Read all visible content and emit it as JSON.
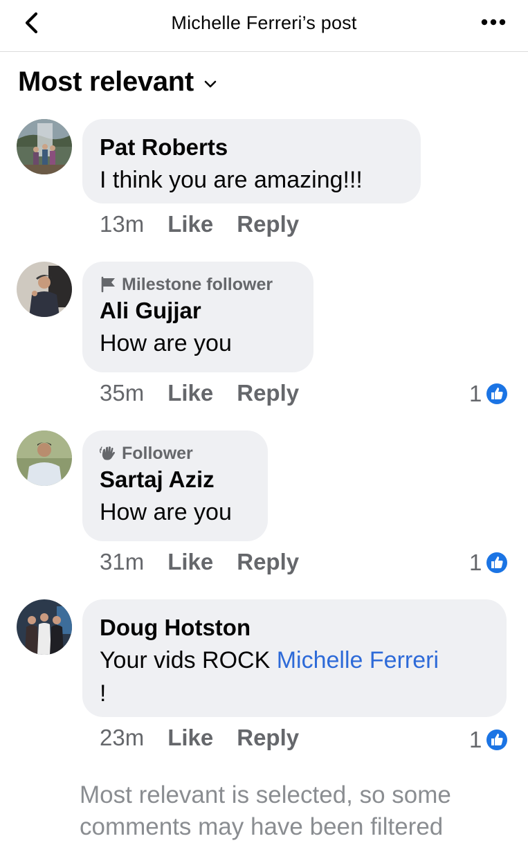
{
  "header": {
    "title": "Michelle Ferreri’s post",
    "back_icon": "chevron-left-icon",
    "more_icon": "more-dots-icon"
  },
  "sort": {
    "label": "Most relevant"
  },
  "comments": [
    {
      "name": "Pat Roberts",
      "badge": "",
      "text": "I think you are amazing!!!",
      "time": "13m",
      "like": "Like",
      "reply": "Reply",
      "reactions": ""
    },
    {
      "name": "Ali Gujjar",
      "badge": "Milestone follower",
      "badge_icon": "flag-icon",
      "text": "How are you",
      "time": "35m",
      "like": "Like",
      "reply": "Reply",
      "reactions": "1"
    },
    {
      "name": "Sartaj Aziz",
      "badge": "Follower",
      "badge_icon": "wave-hand-icon",
      "text": "How are you",
      "time": "31m",
      "like": "Like",
      "reply": "Reply",
      "reactions": "1"
    },
    {
      "name": "Doug Hotston",
      "badge": "",
      "text_before": "Your vids ROCK ",
      "mention": "Michelle Ferreri",
      "text_after": "!",
      "time": "23m",
      "like": "Like",
      "reply": "Reply",
      "reactions": "1"
    }
  ],
  "footer_note": "Most relevant is selected, so some comments may have been filtered",
  "colors": {
    "bubble": "#eff0f3",
    "like_blue": "#1b74e4",
    "mention": "#2d6ad8",
    "muted": "#65676b"
  }
}
